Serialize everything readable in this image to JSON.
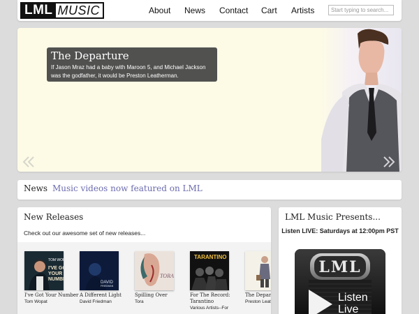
{
  "header": {
    "logo": {
      "primary": "LML",
      "secondary": "MUSIC"
    },
    "nav": [
      "About",
      "News",
      "Contact",
      "Cart",
      "Artists"
    ],
    "search_placeholder": "Start typing to search..."
  },
  "hero": {
    "title": "The Departure",
    "text": "If Jason Mraz had a baby with Maroon 5, and Michael Jackson was the godfather, it would be Preston Leatherman.",
    "prev_icon": "chevron-double-left-icon",
    "next_icon": "chevron-double-right-icon"
  },
  "news": {
    "label": "News",
    "headline": "Music videos now featured on LML"
  },
  "releases": {
    "title": "New Releases",
    "subtitle": "Check out our awesome set of new releases...",
    "albums": [
      {
        "title": "I've Got Your Number",
        "artist": "Tom Wopat",
        "cover_color": "#1a2a33"
      },
      {
        "title": "A Different Light",
        "artist": "David Friedman",
        "cover_color": "#0d1a3a"
      },
      {
        "title": "Spilling Over",
        "artist": "Tora",
        "cover_color": "#e8d8d0"
      },
      {
        "title": "For The Record: Tarantino",
        "artist": "Various Artists--For The Record: Tarantino",
        "cover_color": "#111111"
      },
      {
        "title": "The Departure",
        "artist": "Preston Leatherman",
        "cover_color": "#f4f2e8"
      }
    ]
  },
  "presents": {
    "title": "LML Music Presents...",
    "listen_text": "Listen LIVE: Saturdays at 12:00pm PST",
    "radio_label": "LML",
    "radio_button": "Listen Live",
    "play_icon": "play-icon"
  }
}
